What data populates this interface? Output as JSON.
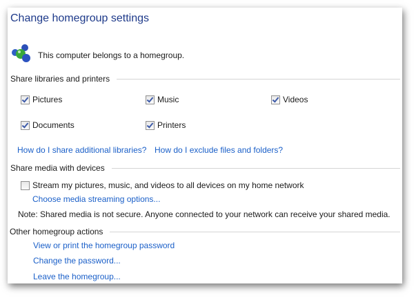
{
  "title": "Change homegroup settings",
  "status": {
    "icon": "homegroup-icon",
    "text": "This computer belongs to a homegroup."
  },
  "share_libraries": {
    "heading": "Share libraries and printers",
    "items": [
      {
        "label": "Pictures",
        "checked": true
      },
      {
        "label": "Music",
        "checked": true
      },
      {
        "label": "Videos",
        "checked": true
      },
      {
        "label": "Documents",
        "checked": true
      },
      {
        "label": "Printers",
        "checked": true
      }
    ],
    "links": [
      "How do I share additional libraries?",
      "How do I exclude files and folders?"
    ]
  },
  "share_media": {
    "heading": "Share media with devices",
    "stream": {
      "label": "Stream my pictures, music, and videos to all devices on my home network",
      "checked": false
    },
    "options_link": "Choose media streaming options...",
    "note": "Note: Shared media is not secure. Anyone connected to your network can receive your shared media."
  },
  "other_actions": {
    "heading": "Other homegroup actions",
    "links": [
      "View or print the homegroup password",
      "Change the password...",
      "Leave the homegroup..."
    ]
  }
}
